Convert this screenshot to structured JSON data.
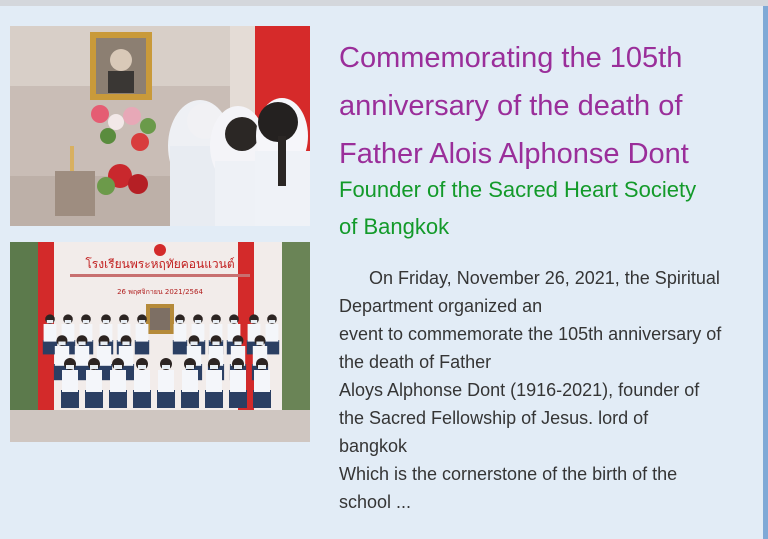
{
  "article": {
    "title_lines": [
      "Commemorating the 105th",
      "anniversary of the death of",
      "Father Alois Alphonse Dont"
    ],
    "subtitle_lines": [
      "Founder of the Sacred Heart Society",
      "of Bangkok"
    ],
    "body_lines": [
      "On Friday, November 26, 2021, the Spiritual",
      "Department organized an",
      "event to commemorate the 105th anniversary of",
      "the death of Father",
      "Aloys Alphonse Dont (1916-2021), founder of",
      "the Sacred Fellowship of Jesus. lord of",
      "bangkok",
      "Which is the cornerstone of the birth of the",
      "school ..."
    ]
  },
  "photos": {
    "banner_heading": "โรงเรียนพระหฤทัยคอนแวนต์",
    "banner_date": "26 พฤศจิกายน 2021/2564"
  },
  "colors": {
    "title": "#9a2e9a",
    "subtitle": "#139a2a",
    "body": "#353535",
    "card_background": "#e2ecf6"
  }
}
